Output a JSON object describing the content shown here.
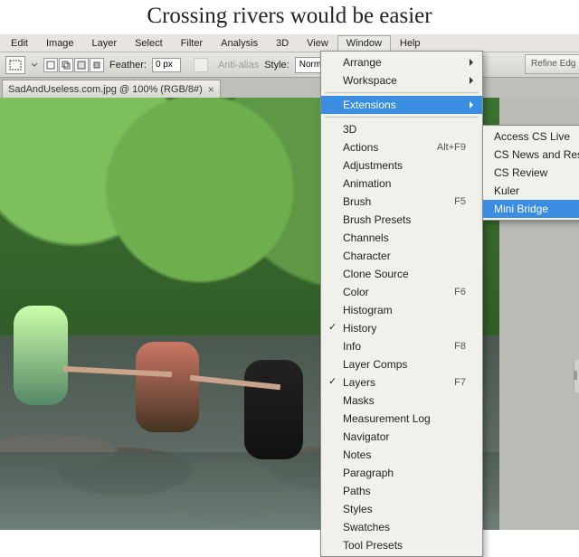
{
  "caption": "Crossing rivers would be easier",
  "menubar": [
    "Edit",
    "Image",
    "Layer",
    "Select",
    "Filter",
    "Analysis",
    "3D",
    "View",
    "Window",
    "Help"
  ],
  "menubar_active_index": 8,
  "toolbar": {
    "feather_label": "Feather:",
    "feather_value": "0 px",
    "antialias_label": "Anti-alias",
    "style_label": "Style:",
    "style_value": "Normal",
    "refine_label": "Refine Edg"
  },
  "doc_tab": {
    "title": "SadAndUseless.com.jpg @ 100% (RGB/8#)",
    "close": "×"
  },
  "window_menu": {
    "top": [
      {
        "label": "Arrange",
        "sub": true
      },
      {
        "label": "Workspace",
        "sub": true
      }
    ],
    "ext": {
      "label": "Extensions",
      "sub": true,
      "highlight": true
    },
    "items": [
      {
        "label": "3D"
      },
      {
        "label": "Actions",
        "shortcut": "Alt+F9"
      },
      {
        "label": "Adjustments"
      },
      {
        "label": "Animation"
      },
      {
        "label": "Brush",
        "shortcut": "F5"
      },
      {
        "label": "Brush Presets"
      },
      {
        "label": "Channels"
      },
      {
        "label": "Character"
      },
      {
        "label": "Clone Source"
      },
      {
        "label": "Color",
        "shortcut": "F6"
      },
      {
        "label": "Histogram"
      },
      {
        "label": "History",
        "checked": true
      },
      {
        "label": "Info",
        "shortcut": "F8"
      },
      {
        "label": "Layer Comps"
      },
      {
        "label": "Layers",
        "shortcut": "F7",
        "checked": true
      },
      {
        "label": "Masks"
      },
      {
        "label": "Measurement Log"
      },
      {
        "label": "Navigator"
      },
      {
        "label": "Notes"
      },
      {
        "label": "Paragraph"
      },
      {
        "label": "Paths"
      },
      {
        "label": "Styles"
      },
      {
        "label": "Swatches"
      },
      {
        "label": "Tool Presets"
      }
    ]
  },
  "extensions_submenu": [
    {
      "label": "Access CS Live"
    },
    {
      "label": "CS News and Reso"
    },
    {
      "label": "CS Review"
    },
    {
      "label": "Kuler"
    },
    {
      "label": "Mini Bridge",
      "highlight": true
    }
  ]
}
